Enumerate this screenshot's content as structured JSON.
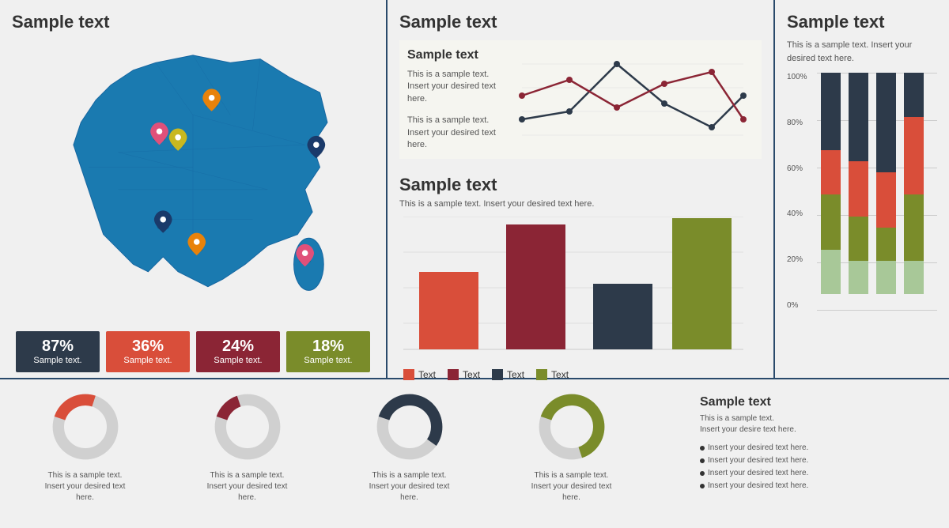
{
  "left": {
    "title": "Sample text",
    "stats": [
      {
        "percent": "87%",
        "label": "Sample text.",
        "style": "dark"
      },
      {
        "percent": "36%",
        "label": "Sample text.",
        "style": "red"
      },
      {
        "percent": "24%",
        "label": "Sample text.",
        "style": "darkred"
      },
      {
        "percent": "18%",
        "label": "Sample text.",
        "style": "olive"
      }
    ]
  },
  "middle": {
    "title": "Sample text",
    "lineChart": {
      "title": "Sample text",
      "text1": "This is a sample text. Insert your desired text here.",
      "text2": "This is a sample text. Insert your desired text here."
    },
    "barChart": {
      "title": "Sample text",
      "desc": "This is a sample text. Insert your desired text here.",
      "bars": [
        {
          "label": "Text",
          "color": "#d94e3a",
          "height": 55
        },
        {
          "label": "Text",
          "color": "#8b2535",
          "height": 80
        },
        {
          "label": "Text",
          "color": "#2d3a4a",
          "height": 45
        },
        {
          "label": "Text",
          "color": "#7a8c2a",
          "height": 88
        }
      ]
    }
  },
  "right": {
    "title": "Sample text",
    "text": "This is a sample text. Insert your desired text here.",
    "yLabels": [
      "100%",
      "80%",
      "60%",
      "40%",
      "20%",
      "0%"
    ],
    "cols": [
      {
        "segs": [
          {
            "color": "#2d3a4a",
            "pct": 35
          },
          {
            "color": "#d94e3a",
            "pct": 30
          },
          {
            "color": "#7a8c2a",
            "pct": 20
          },
          {
            "color": "#8fbc8f",
            "pct": 15
          }
        ]
      },
      {
        "segs": [
          {
            "color": "#2d3a4a",
            "pct": 40
          },
          {
            "color": "#d94e3a",
            "pct": 25
          },
          {
            "color": "#7a8c2a",
            "pct": 20
          },
          {
            "color": "#8fbc8f",
            "pct": 15
          }
        ]
      },
      {
        "segs": [
          {
            "color": "#2d3a4a",
            "pct": 45
          },
          {
            "color": "#d94e3a",
            "pct": 25
          },
          {
            "color": "#7a8c2a",
            "pct": 15
          },
          {
            "color": "#8fbc8f",
            "pct": 15
          }
        ]
      },
      {
        "segs": [
          {
            "color": "#2d3a4a",
            "pct": 20
          },
          {
            "color": "#d94e3a",
            "pct": 35
          },
          {
            "color": "#7a8c2a",
            "pct": 30
          },
          {
            "color": "#8fbc8f",
            "pct": 15
          }
        ]
      }
    ]
  },
  "bottom": {
    "donuts": [
      {
        "pct": 25,
        "color": "#d94e3a",
        "text": "This is a sample text. Insert your desired text here."
      },
      {
        "pct": 15,
        "color": "#8b2535",
        "text": "This is a sample text. Insert your desired text here."
      },
      {
        "pct": 55,
        "color": "#2d3a4a",
        "text": "This is a sample text. Insert your desired text here."
      },
      {
        "pct": 65,
        "color": "#7a8c2a",
        "text": "This is a sample text. Insert your desired text here."
      }
    ],
    "textPanel": {
      "title": "Sample text",
      "desc": "This is a sample text. Insert your desire text here.",
      "bullets": [
        "Insert your desired text here.",
        "Insert your desired text here.",
        "Insert your desired text here.",
        "Insert your desired text here."
      ]
    }
  }
}
